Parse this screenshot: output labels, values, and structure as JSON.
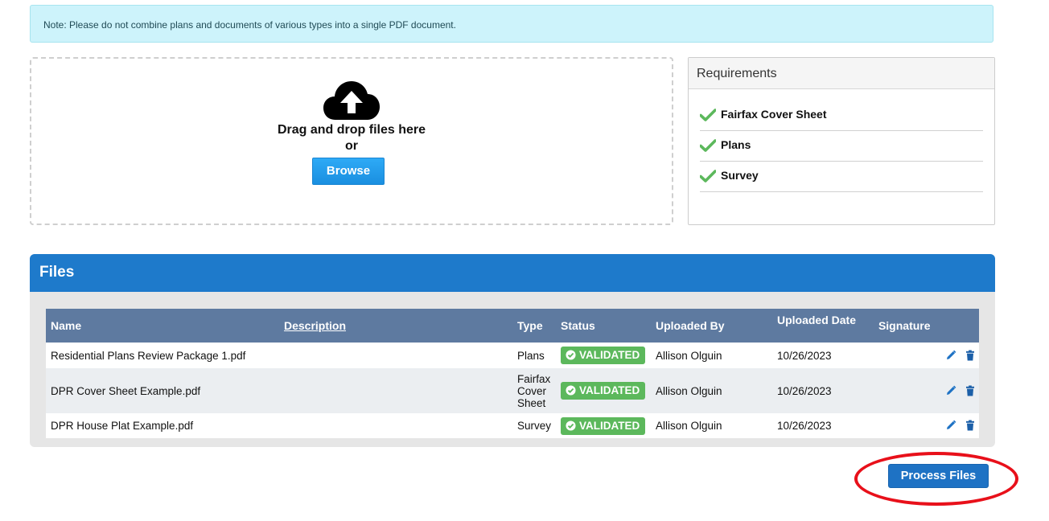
{
  "note": {
    "text": "Note: Please do not combine plans and documents of various types into a single PDF document."
  },
  "dropzone": {
    "icon": "cloud-upload-icon",
    "primary_text": "Drag and drop files here",
    "or_text": "or",
    "browse_label": "Browse",
    "browse_color": "#1a8fe0"
  },
  "requirements": {
    "title": "Requirements",
    "check_color": "#5cb85c",
    "items": [
      {
        "label": "Fairfax Cover Sheet",
        "met": true
      },
      {
        "label": "Plans",
        "met": true
      },
      {
        "label": "Survey",
        "met": true
      }
    ]
  },
  "files": {
    "title": "Files",
    "header_color": "#1e7acb",
    "columns": {
      "name": "Name",
      "description": "Description",
      "type": "Type",
      "status": "Status",
      "uploaded_by": "Uploaded By",
      "uploaded_date": "Uploaded Date",
      "signature": "Signature"
    },
    "rows": [
      {
        "name": "Residential Plans Review Package 1.pdf",
        "description": "",
        "type": "Plans",
        "status": "VALIDATED",
        "uploaded_by": "Allison Olguin",
        "uploaded_date": "10/26/2023",
        "signature": ""
      },
      {
        "name": "DPR Cover Sheet Example.pdf",
        "description": "",
        "type": "Fairfax Cover Sheet",
        "status": "VALIDATED",
        "uploaded_by": "Allison Olguin",
        "uploaded_date": "10/26/2023",
        "signature": ""
      },
      {
        "name": "DPR House Plat Example.pdf",
        "description": "",
        "type": "Survey",
        "status": "VALIDATED",
        "uploaded_by": "Allison Olguin",
        "uploaded_date": "10/26/2023",
        "signature": ""
      }
    ],
    "status_color": "#5cb85c",
    "row_icons": [
      "pencil-icon",
      "trash-icon"
    ]
  },
  "process_button": {
    "label": "Process Files",
    "color": "#1e72c4",
    "highlight_color": "#e8101a"
  }
}
